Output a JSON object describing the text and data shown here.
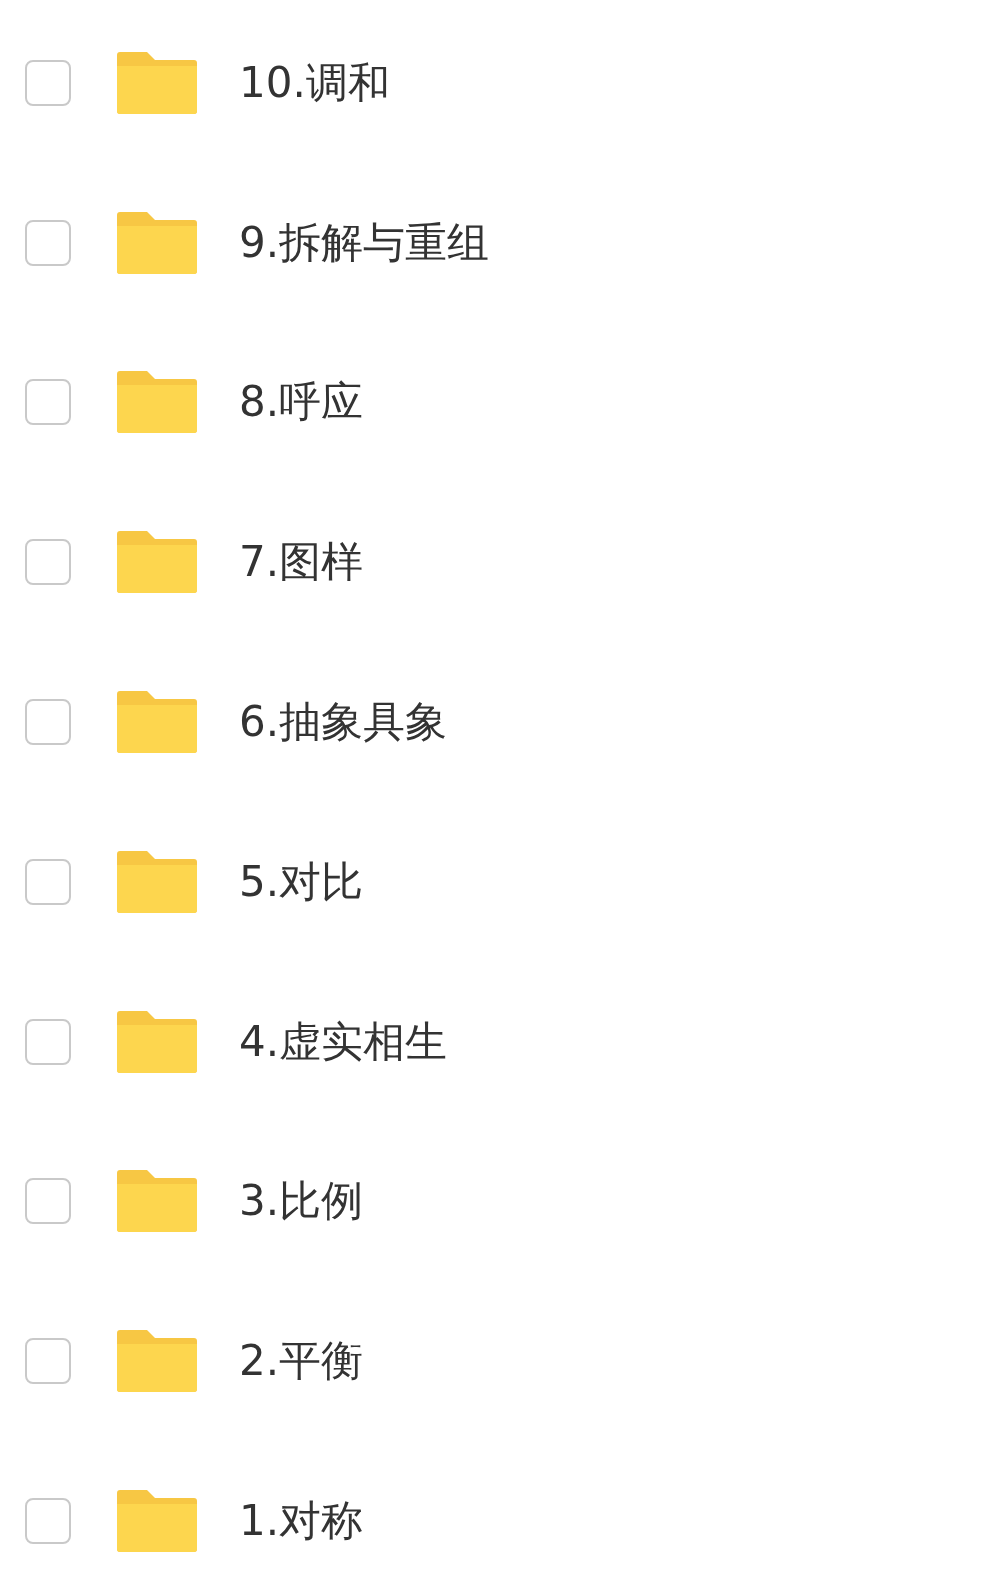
{
  "files": [
    {
      "name": "10.调和",
      "checked": false
    },
    {
      "name": "9.拆解与重组",
      "checked": false
    },
    {
      "name": "8.呼应",
      "checked": false
    },
    {
      "name": "7.图样",
      "checked": false
    },
    {
      "name": "6.抽象具象",
      "checked": false
    },
    {
      "name": "5.对比",
      "checked": false
    },
    {
      "name": "4.虚实相生",
      "checked": false
    },
    {
      "name": "3.比例",
      "checked": false
    },
    {
      "name": "2.平衡",
      "checked": false
    },
    {
      "name": "1.对称",
      "checked": false
    }
  ]
}
